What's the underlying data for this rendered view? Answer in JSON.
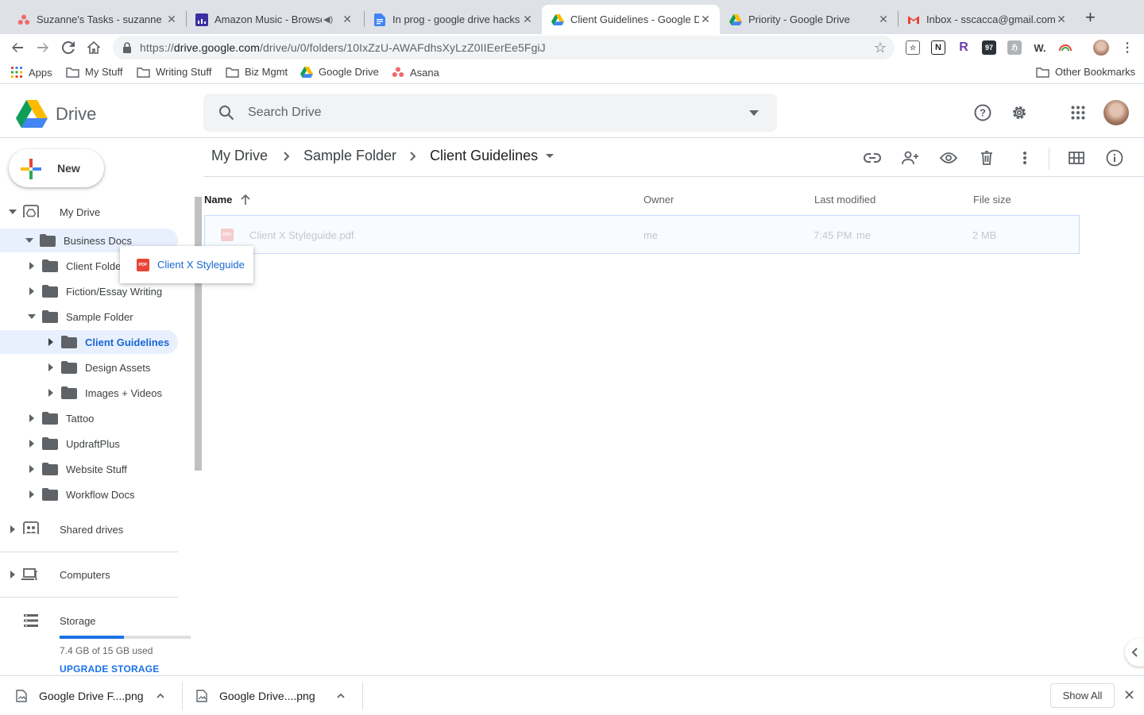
{
  "browser": {
    "tabs": [
      {
        "title": "Suzanne's Tasks - suzanne",
        "icon": "asana-icon",
        "active": false
      },
      {
        "title": "Amazon Music - Browse",
        "icon": "amazon-music-icon",
        "active": false
      },
      {
        "title": "In prog - google drive hacks",
        "icon": "google-docs-icon",
        "active": false
      },
      {
        "title": "Client Guidelines - Google D",
        "icon": "google-drive-icon",
        "active": true
      },
      {
        "title": "Priority - Google Drive",
        "icon": "google-drive-icon",
        "active": false
      },
      {
        "title": "Inbox - sscacca@gmail.com",
        "icon": "gmail-icon",
        "active": false
      }
    ],
    "url_prefix": "https://",
    "url_host": "drive.google.com",
    "url_path": "/drive/u/0/folders/10IxZzU-AWAFdhsXyLzZ0IIEerEe5FgiJ",
    "bookmarks": [
      {
        "label": "Apps",
        "icon": "apps-grid-icon"
      },
      {
        "label": "My Stuff",
        "icon": "folder-icon"
      },
      {
        "label": "Writing Stuff",
        "icon": "folder-icon"
      },
      {
        "label": "Biz Mgmt",
        "icon": "folder-icon"
      },
      {
        "label": "Google Drive",
        "icon": "google-drive-icon"
      },
      {
        "label": "Asana",
        "icon": "asana-icon"
      }
    ],
    "other_bookmarks": "Other Bookmarks",
    "extensions": [
      "N",
      "R",
      "97",
      "W."
    ]
  },
  "drive": {
    "logo_text": "Drive",
    "search_placeholder": "Search Drive",
    "new_button": "New",
    "tree": {
      "my_drive": "My Drive",
      "business_docs": "Business Docs",
      "client_folder": "Client Folde",
      "fiction": "Fiction/Essay Writing",
      "sample_folder": "Sample Folder",
      "client_guidelines": "Client Guidelines",
      "design_assets": "Design Assets",
      "images_videos": "Images + Videos",
      "tattoo": "Tattoo",
      "updraftplus": "UpdraftPlus",
      "website_stuff": "Website Stuff",
      "workflow_docs": "Workflow Docs",
      "shared_drives": "Shared drives",
      "computers": "Computers",
      "storage": "Storage"
    },
    "storage": {
      "used_text": "7.4 GB of 15 GB used",
      "used_fraction": 0.49,
      "upgrade": "UPGRADE STORAGE"
    },
    "breadcrumb": [
      "My Drive",
      "Sample Folder",
      "Client Guidelines"
    ],
    "columns": {
      "name": "Name",
      "owner": "Owner",
      "modified": "Last modified",
      "size": "File size"
    },
    "files": [
      {
        "name": "Client X Styleguide.pdf",
        "owner": "me",
        "modified": "7:45 PM",
        "modified_by": "me",
        "size": "2 MB"
      }
    ],
    "drag_label": "Client X Styleguide",
    "pdf_badge": "PDF"
  },
  "downloads": {
    "items": [
      "Google Drive F....png",
      "Google Drive....png"
    ],
    "show_all": "Show All"
  },
  "colors": {
    "accent": "#1967d2",
    "selected_bg": "#e8f0fe",
    "folder": "#5f6368"
  }
}
